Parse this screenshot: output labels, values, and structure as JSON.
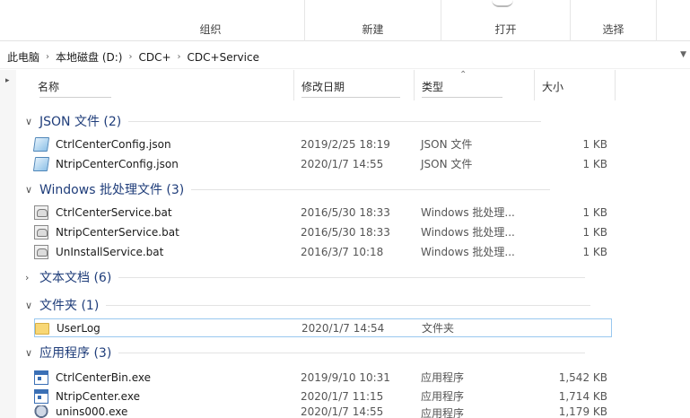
{
  "ribbon": {
    "groups": [
      "组织",
      "新建",
      "打开",
      "选择"
    ]
  },
  "address": {
    "segments": [
      "此电脑",
      "本地磁盘 (D:)",
      "CDC+",
      "CDC+Service"
    ]
  },
  "columns": {
    "name": "名称",
    "date": "修改日期",
    "type": "类型",
    "size": "大小"
  },
  "groups": [
    {
      "label": "JSON 文件 (2)",
      "expanded": true,
      "icon": "json-file-icon",
      "items": [
        {
          "name": "CtrlCenterConfig.json",
          "date": "2019/2/25 18:19",
          "type": "JSON 文件",
          "size": "1 KB"
        },
        {
          "name": "NtripCenterConfig.json",
          "date": "2020/1/7 14:55",
          "type": "JSON 文件",
          "size": "1 KB"
        }
      ]
    },
    {
      "label": "Windows 批处理文件 (3)",
      "expanded": true,
      "icon": "batch-file-icon",
      "items": [
        {
          "name": "CtrlCenterService.bat",
          "date": "2016/5/30 18:33",
          "type": "Windows 批处理...",
          "size": "1 KB"
        },
        {
          "name": "NtripCenterService.bat",
          "date": "2016/5/30 18:33",
          "type": "Windows 批处理...",
          "size": "1 KB"
        },
        {
          "name": "UnInstallService.bat",
          "date": "2016/3/7 10:18",
          "type": "Windows 批处理...",
          "size": "1 KB"
        }
      ]
    },
    {
      "label": "文本文档 (6)",
      "expanded": false,
      "items": []
    },
    {
      "label": "文件夹 (1)",
      "expanded": true,
      "icon": "folder-icon",
      "items": [
        {
          "name": "UserLog",
          "date": "2020/1/7 14:54",
          "type": "文件夹",
          "size": ""
        }
      ]
    },
    {
      "label": "应用程序 (3)",
      "expanded": true,
      "icon": "exe-icon",
      "items": [
        {
          "name": "CtrlCenterBin.exe",
          "date": "2019/9/10 10:31",
          "type": "应用程序",
          "size": "1,542 KB"
        },
        {
          "name": "NtripCenter.exe",
          "date": "2020/1/7 11:15",
          "type": "应用程序",
          "size": "1,714 KB"
        },
        {
          "name": "unins000.exe",
          "date": "2020/1/7 14:55",
          "type": "应用程序",
          "size": "1,179 KB"
        }
      ]
    }
  ],
  "colors": {
    "group_header": "#1f3d7a",
    "selection_border": "#99c8ef",
    "folder": "#f8d775"
  }
}
